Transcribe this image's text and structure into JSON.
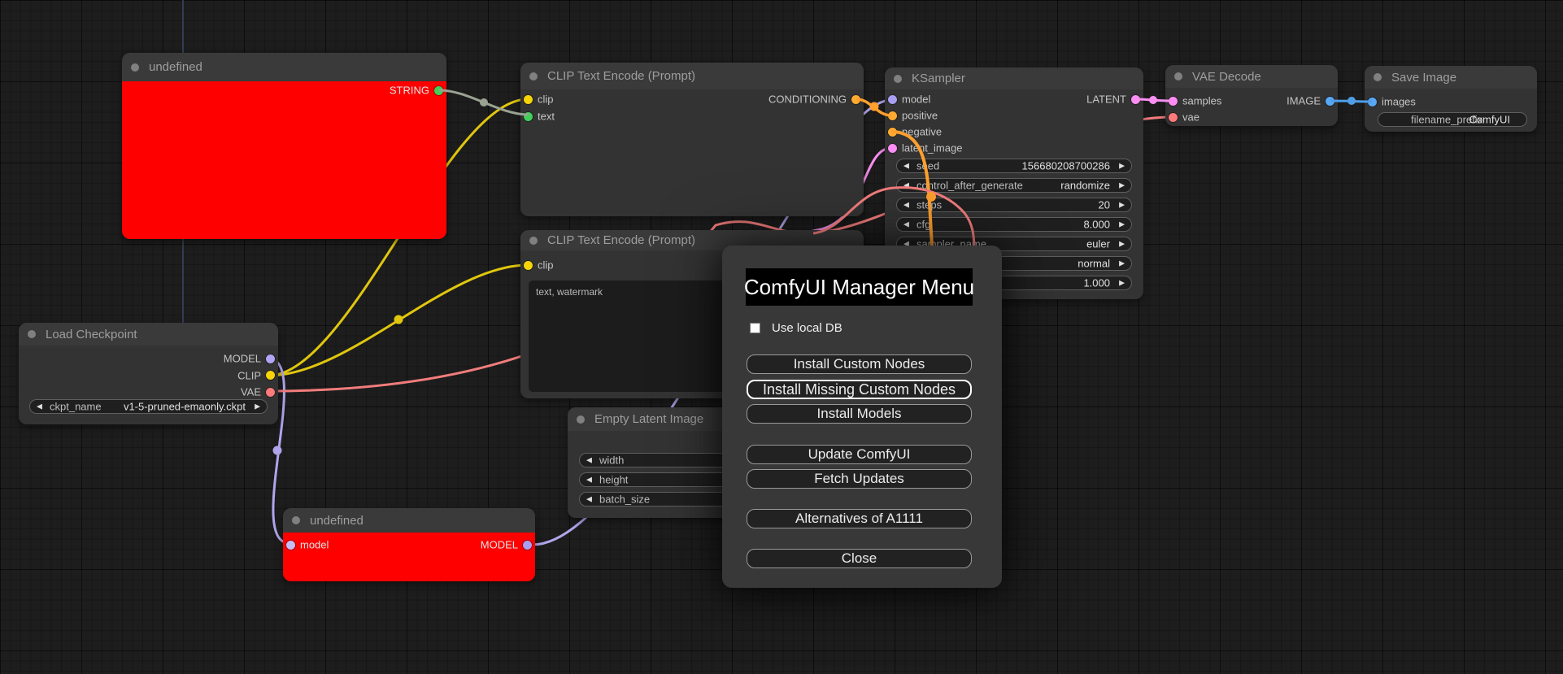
{
  "canvas": {
    "background": "#1d1d1d"
  },
  "icons": {
    "widget_decrement": "◀",
    "widget_increment": "▶",
    "node_title_dot": "circle",
    "checkbox": "square"
  },
  "link_colors": {
    "clip": "#e0c60e",
    "string": "#9aa392",
    "model": "#b0a5ec",
    "vae": "#f27c7c",
    "conditioning": "#ff9f2e",
    "latent": "#f98ff0",
    "image": "#4f9ee8",
    "guide_line": "#3a4a66"
  },
  "nodes": [
    {
      "id": "undefined-top",
      "title": "undefined",
      "type": "red",
      "inputs": [],
      "outputs": [
        {
          "label": "STRING",
          "color": "#3fd157"
        }
      ],
      "widgets": []
    },
    {
      "id": "clip-text-encode-1",
      "title": "CLIP Text Encode (Prompt)",
      "type": "normal",
      "inputs": [
        {
          "label": "clip",
          "color": "#f7d408"
        },
        {
          "label": "text",
          "color": "#3fd157"
        }
      ],
      "outputs": [
        {
          "label": "CONDITIONING",
          "color": "#ffab30"
        }
      ],
      "widgets": []
    },
    {
      "id": "ksampler",
      "title": "KSampler",
      "type": "normal",
      "inputs": [
        {
          "label": "model",
          "color": "#a99ef2"
        },
        {
          "label": "positive",
          "color": "#ffab30"
        },
        {
          "label": "negative",
          "color": "#ffab30"
        },
        {
          "label": "latent_image",
          "color": "#ff8cf4"
        }
      ],
      "outputs": [
        {
          "label": "LATENT",
          "color": "#ff8cf4"
        }
      ],
      "widgets": [
        {
          "label": "seed",
          "value": "156680208700286",
          "arrows": "both"
        },
        {
          "label": "control_after_generate",
          "value": "randomize",
          "arrows": "both"
        },
        {
          "label": "steps",
          "value": "20",
          "arrows": "both"
        },
        {
          "label": "cfg",
          "value": "8.000",
          "arrows": "both"
        },
        {
          "label": "sampler_name",
          "value": "euler",
          "arrows": "both"
        },
        {
          "label": "",
          "value": "normal",
          "arrows": "both"
        },
        {
          "label": "",
          "value": "1.000",
          "arrows": "both"
        }
      ]
    },
    {
      "id": "vae-decode",
      "title": "VAE Decode",
      "type": "normal",
      "inputs": [
        {
          "label": "samples",
          "color": "#ff8cf4"
        },
        {
          "label": "vae",
          "color": "#ff7a7a"
        }
      ],
      "outputs": [
        {
          "label": "IMAGE",
          "color": "#57a8f5"
        }
      ],
      "widgets": []
    },
    {
      "id": "save-image",
      "title": "Save Image",
      "type": "normal",
      "inputs": [
        {
          "label": "images",
          "color": "#57a8f5"
        }
      ],
      "outputs": [],
      "widgets": [
        {
          "label": "filename_prefix",
          "value": "ComfyUI",
          "arrows": "none"
        }
      ]
    },
    {
      "id": "load-checkpoint",
      "title": "Load Checkpoint",
      "type": "normal",
      "inputs": [],
      "outputs": [
        {
          "label": "MODEL",
          "color": "#b1a5f5"
        },
        {
          "label": "CLIP",
          "color": "#f7d408"
        },
        {
          "label": "VAE",
          "color": "#ff7a7a"
        }
      ],
      "widgets": [
        {
          "label": "ckpt_name",
          "value": "v1-5-pruned-emaonly.ckpt",
          "arrows": "both"
        }
      ]
    },
    {
      "id": "clip-text-encode-2",
      "title": "CLIP Text Encode (Prompt)",
      "type": "normal",
      "inputs": [
        {
          "label": "clip",
          "color": "#f7d408"
        }
      ],
      "outputs": [],
      "widgets": [],
      "textarea": "text, watermark"
    },
    {
      "id": "empty-latent-image",
      "title": "Empty Latent Image",
      "type": "normal",
      "inputs": [],
      "outputs": [],
      "widgets": [
        {
          "label": "width",
          "value": "",
          "arrows": "left"
        },
        {
          "label": "height",
          "value": "",
          "arrows": "left"
        },
        {
          "label": "batch_size",
          "value": "",
          "arrows": "left"
        }
      ]
    },
    {
      "id": "undefined-bottom",
      "title": "undefined",
      "type": "red",
      "inputs": [
        {
          "label": "model",
          "color": "#c7bcf7"
        }
      ],
      "outputs": [
        {
          "label": "MODEL",
          "color": "#a99ef2"
        }
      ],
      "widgets": []
    }
  ],
  "dialog": {
    "title": "ComfyUI Manager Menu",
    "checkbox_label": "Use local DB",
    "checkbox_checked": false,
    "buttons": [
      {
        "id": "install-custom-nodes",
        "label": "Install Custom Nodes",
        "highlight": false
      },
      {
        "id": "install-missing-custom-nodes",
        "label": "Install Missing Custom Nodes",
        "highlight": true
      },
      {
        "id": "install-models",
        "label": "Install Models",
        "highlight": false
      },
      {
        "id": "update-comfyui",
        "label": "Update ComfyUI",
        "highlight": false
      },
      {
        "id": "fetch-updates",
        "label": "Fetch Updates",
        "highlight": false
      },
      {
        "id": "alternatives-of-a1111",
        "label": "Alternatives of A1111",
        "highlight": false
      },
      {
        "id": "close",
        "label": "Close",
        "highlight": false
      }
    ]
  }
}
